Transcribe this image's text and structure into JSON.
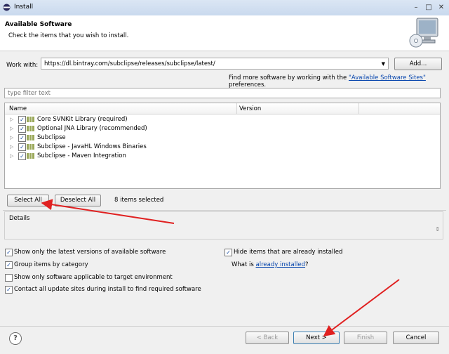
{
  "window": {
    "title": "Install"
  },
  "header": {
    "title": "Available Software",
    "subtitle": "Check the items that you wish to install."
  },
  "work_with": {
    "label": "Work with:",
    "value": "https://dl.bintray.com/subclipse/releases/subclipse/latest/",
    "add_label": "Add..."
  },
  "find_more": {
    "prefix": "Find more software by working with the ",
    "link": "\"Available Software Sites\"",
    "suffix": " preferences."
  },
  "filter": {
    "placeholder": "type filter text"
  },
  "tree": {
    "columns": {
      "name": "Name",
      "version": "Version"
    },
    "items": [
      {
        "label": "Core SVNKit Library (required)",
        "checked": true
      },
      {
        "label": "Optional JNA Library (recommended)",
        "checked": true
      },
      {
        "label": "Subclipse",
        "checked": true
      },
      {
        "label": "Subclipse - JavaHL Windows Binaries",
        "checked": true
      },
      {
        "label": "Subclipse - Maven Integration",
        "checked": true
      }
    ]
  },
  "selection": {
    "select_all": "Select All",
    "deselect_all": "Deselect All",
    "count": "8 items selected"
  },
  "details": {
    "label": "Details"
  },
  "options": {
    "latest_versions": "Show only the latest versions of available software",
    "group_by_category": "Group items by category",
    "target_env": "Show only software applicable to target environment",
    "contact_sites": "Contact all update sites during install to find required software",
    "hide_installed": "Hide items that are already installed",
    "what_is_prefix": "What is ",
    "what_is_link": "already installed",
    "what_is_suffix": "?"
  },
  "footer": {
    "help": "?",
    "back": "< Back",
    "next": "Next >",
    "finish": "Finish",
    "cancel": "Cancel"
  },
  "colors": {
    "annotation_arrow": "#e02020",
    "link": "#0645ad"
  }
}
